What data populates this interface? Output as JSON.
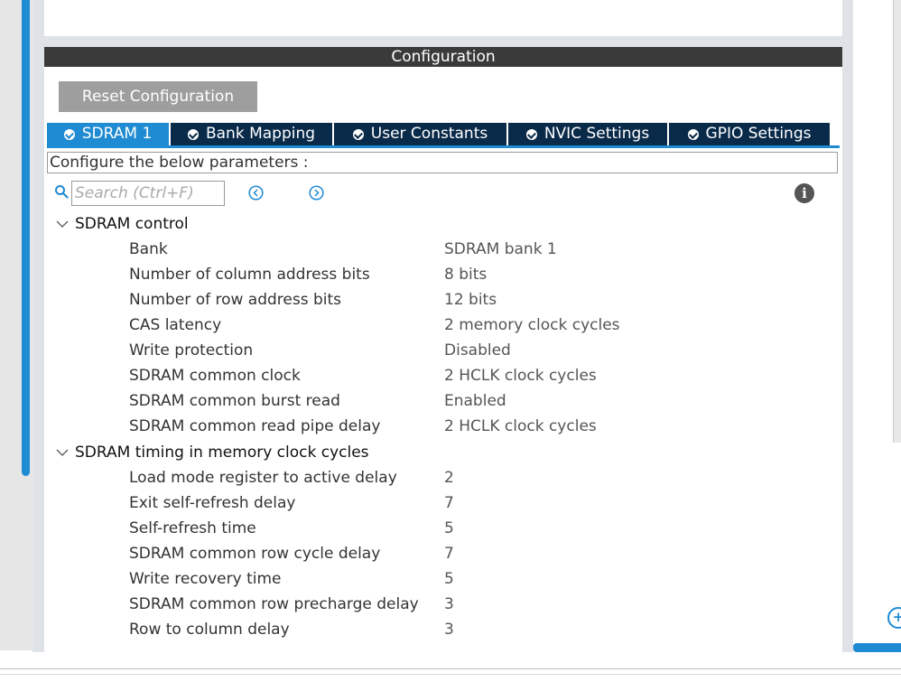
{
  "panel": {
    "title": "Configuration",
    "reset_button": "Reset Configuration"
  },
  "tabs": [
    {
      "label": "SDRAM 1",
      "active": true
    },
    {
      "label": "Bank Mapping",
      "active": false
    },
    {
      "label": "User Constants",
      "active": false
    },
    {
      "label": "NVIC Settings",
      "active": false
    },
    {
      "label": "GPIO Settings",
      "active": false
    }
  ],
  "params_label": "Configure the below parameters :",
  "search": {
    "placeholder": "Search (Ctrl+F)"
  },
  "sections": [
    {
      "title": "SDRAM control",
      "rows": [
        {
          "name": "Bank",
          "value": "SDRAM bank 1"
        },
        {
          "name": "Number of column address bits",
          "value": "8 bits"
        },
        {
          "name": "Number of row address bits",
          "value": "12 bits"
        },
        {
          "name": "CAS latency",
          "value": "2 memory clock cycles"
        },
        {
          "name": "Write protection",
          "value": "Disabled"
        },
        {
          "name": "SDRAM common clock",
          "value": "2 HCLK clock cycles"
        },
        {
          "name": "SDRAM common burst read",
          "value": "Enabled"
        },
        {
          "name": "SDRAM common read pipe delay",
          "value": "2 HCLK clock cycles"
        }
      ]
    },
    {
      "title": "SDRAM timing in memory clock cycles",
      "rows": [
        {
          "name": "Load mode register to active delay",
          "value": "2"
        },
        {
          "name": "Exit self-refresh delay",
          "value": "7"
        },
        {
          "name": "Self-refresh time",
          "value": "5"
        },
        {
          "name": "SDRAM common row cycle delay",
          "value": "7"
        },
        {
          "name": "Write recovery time",
          "value": "5"
        },
        {
          "name": "SDRAM common row precharge delay",
          "value": "3"
        },
        {
          "name": "Row to column delay",
          "value": "3"
        }
      ]
    }
  ],
  "colors": {
    "accent": "#1f8bd3",
    "tab_dark": "#0a2a4a",
    "header": "#3a3a3a",
    "button": "#9e9e9e"
  }
}
